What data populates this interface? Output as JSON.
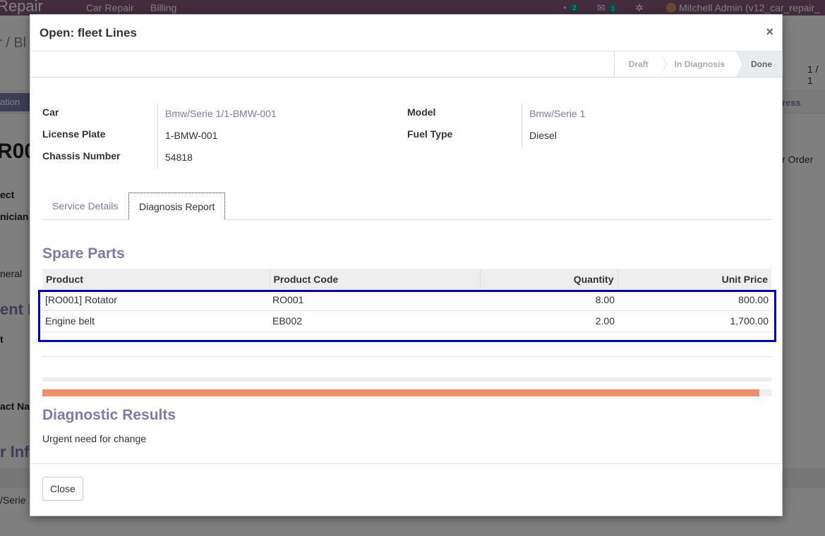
{
  "background": {
    "app_name": "Repair",
    "menus": [
      "Car Repair",
      "Billing"
    ],
    "activity_count": "2",
    "message_count": "1",
    "user": "Mitchell Admin (v12_car_repair_",
    "breadcrumb": "r / Bl",
    "pager": "1 / 1",
    "primary_button": "ation",
    "stage": "gress",
    "record_fragment": "R00",
    "labels": [
      "ect",
      "nician",
      "neral",
      "t",
      "act Na"
    ],
    "heading_fragment_1": "ent In",
    "heading_fragment_2": "r Info",
    "order_text": "r Order",
    "row_fragment": "/Serie"
  },
  "modal": {
    "title": "Open: fleet Lines",
    "close_symbol": "×"
  },
  "status": {
    "stages": [
      "Draft",
      "In Diagnosis",
      "Done"
    ],
    "active_stage": "Done"
  },
  "fields": {
    "car_label": "Car",
    "car_value": "Bmw/Serie 1/1-BMW-001",
    "license_label": "License Plate",
    "license_value": "1-BMW-001",
    "chassis_label": "Chassis Number",
    "chassis_value": "54818",
    "model_label": "Model",
    "model_value": "Bmw/Serie 1",
    "fuel_label": "Fuel Type",
    "fuel_value": "Diesel"
  },
  "tabs": [
    "Service Details",
    "Diagnosis Report"
  ],
  "active_tab": "Diagnosis Report",
  "spare_parts": {
    "title": "Spare Parts",
    "columns": [
      "Product",
      "Product Code",
      "Quantity",
      "Unit Price"
    ],
    "rows": [
      {
        "product": "[RO001] Rotator",
        "code": "RO001",
        "quantity": "8.00",
        "price": "800.00"
      },
      {
        "product": "Engine belt",
        "code": "EB002",
        "quantity": "2.00",
        "price": "1,700.00"
      }
    ]
  },
  "progress": {
    "fill_percent": 98.4,
    "color": "#f0906a"
  },
  "diagnostic": {
    "title": "Diagnostic Results",
    "text": "Urgent need for change"
  },
  "footer": {
    "close_label": "Close"
  },
  "colors": {
    "accent": "#7c7bad",
    "navbar": "#875a7b",
    "highlight": "#0000cc"
  }
}
